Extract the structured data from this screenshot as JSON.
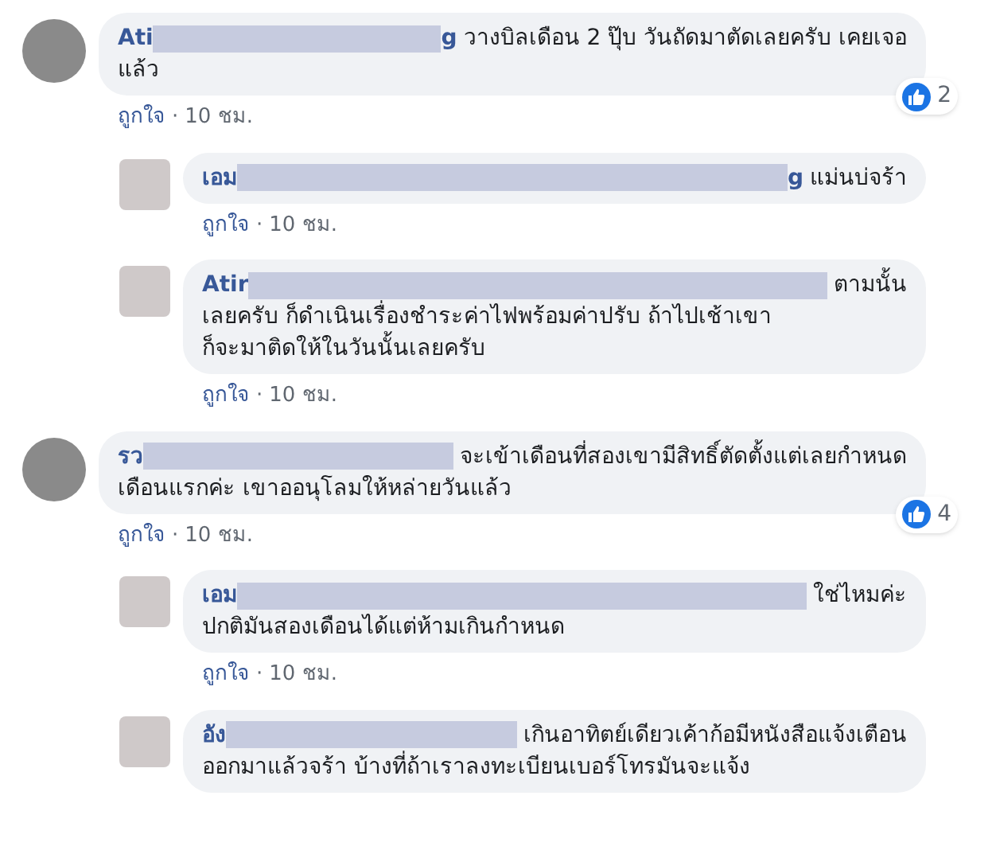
{
  "comments": [
    {
      "name": "Ati",
      "name_tail": "g",
      "text_lines": [
        "วางบิลเดือน 2 ปุ๊บ วันถัดมาตัดเลยครับ เคยเจอ",
        "แล้ว"
      ],
      "like": "ถูกใจ",
      "separator": "·",
      "time": "10 ชม.",
      "reaction_count": "2",
      "replies": [
        {
          "name": "เอม",
          "name_tail": "g",
          "text_lines": [
            "แม่นบ่จร้า"
          ],
          "like": "ถูกใจ",
          "separator": "·",
          "time": "10 ชม."
        },
        {
          "name": "Atir",
          "text_lines": [
            "ตามนั้น",
            "เลยครับ ก็ดำเนินเรื่องชำระค่าไฟพร้อมค่าปรับ ถ้าไปเช้าเขา",
            "ก็จะมาติดให้ในวันนั้นเลยครับ"
          ],
          "like": "ถูกใจ",
          "separator": "·",
          "time": "10 ชม."
        }
      ]
    },
    {
      "name": "รว",
      "text_lines": [
        "จะเข้าเดือนที่สองเขามีสิทธิ์ตัดตั้งแต่เลยกำหนด",
        "เดือนแรกค่ะ เขาออนุโลมให้หล่ายวันแล้ว"
      ],
      "like": "ถูกใจ",
      "separator": "·",
      "time": "10 ชม.",
      "reaction_count": "4",
      "replies": [
        {
          "name": "เอม",
          "text_lines": [
            "ใช่ไหมค่ะ",
            "ปกติมันสองเดือนได้แต่ห้ามเกินกำหนด"
          ],
          "like": "ถูกใจ",
          "separator": "·",
          "time": "10 ชม."
        },
        {
          "name": "อัง",
          "text_lines": [
            "เกินอาทิตย์เดียวเค้าก้อมีหนังสือแจ้งเตือน",
            "ออกมาแล้วจร้า บ้างที่ถ้าเราลงทะเบียนเบอร์โทรมันจะแจ้ง"
          ]
        }
      ]
    }
  ]
}
